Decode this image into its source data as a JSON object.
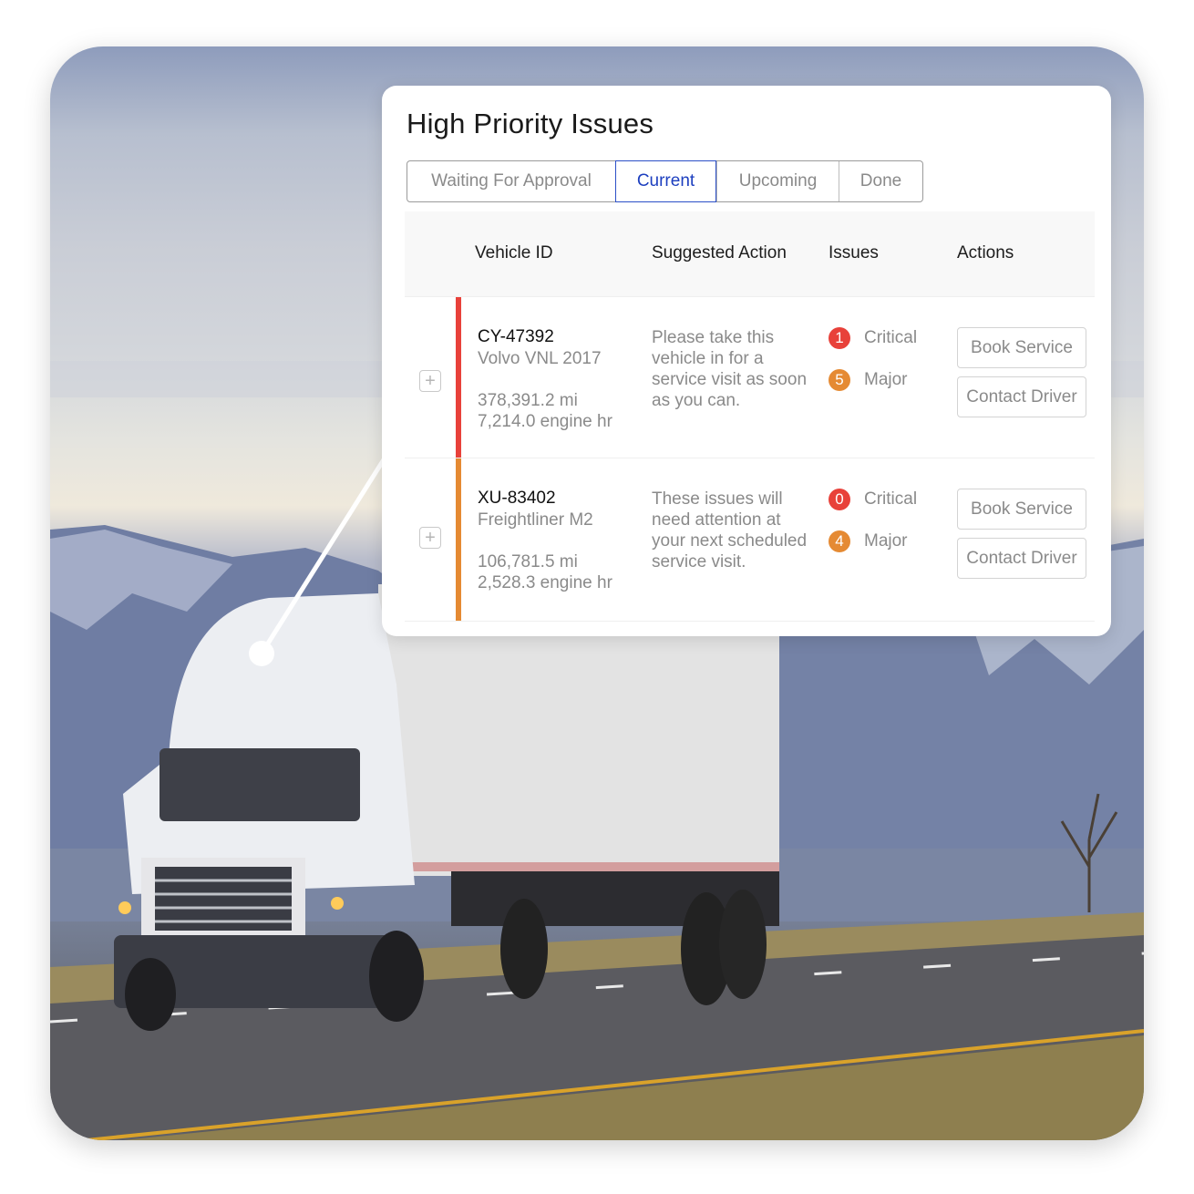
{
  "card": {
    "title": "High Priority Issues",
    "tabs": [
      {
        "label": "Waiting For Approval",
        "active": false
      },
      {
        "label": "Current",
        "active": true
      },
      {
        "label": "Upcoming",
        "active": false
      },
      {
        "label": "Done",
        "active": false
      }
    ],
    "columns": [
      "Vehicle ID",
      "Suggested Action",
      "Issues",
      "Actions"
    ],
    "rows": [
      {
        "vehicle_id": "CY-47392",
        "model": "Volvo VNL 2017",
        "mileage": "378,391.2 mi",
        "engine_hours": "7,214.0 engine hr",
        "suggested_action": "Please take this vehicle in for a service visit as soon as you can.",
        "severity_color": "#e8413a",
        "issues": [
          {
            "count": "1",
            "label": "Critical",
            "color": "#e8413a"
          },
          {
            "count": "5",
            "label": "Major",
            "color": "#e58a33"
          }
        ],
        "actions": [
          "Book Service",
          "Contact Driver"
        ],
        "expand_icon": "+"
      },
      {
        "vehicle_id": "XU-83402",
        "model": "Freightliner M2",
        "mileage": "106,781.5 mi",
        "engine_hours": "2,528.3 engine hr",
        "suggested_action": "These issues will need attention at your next scheduled service visit.",
        "severity_color": "#e58a33",
        "issues": [
          {
            "count": "0",
            "label": "Critical",
            "color": "#e8413a"
          },
          {
            "count": "4",
            "label": "Major",
            "color": "#e58a33"
          }
        ],
        "actions": [
          "Book Service",
          "Contact Driver"
        ],
        "expand_icon": "+"
      }
    ]
  },
  "colors": {
    "accent": "#1d3fbf",
    "critical": "#e8413a",
    "major": "#e58a33"
  }
}
